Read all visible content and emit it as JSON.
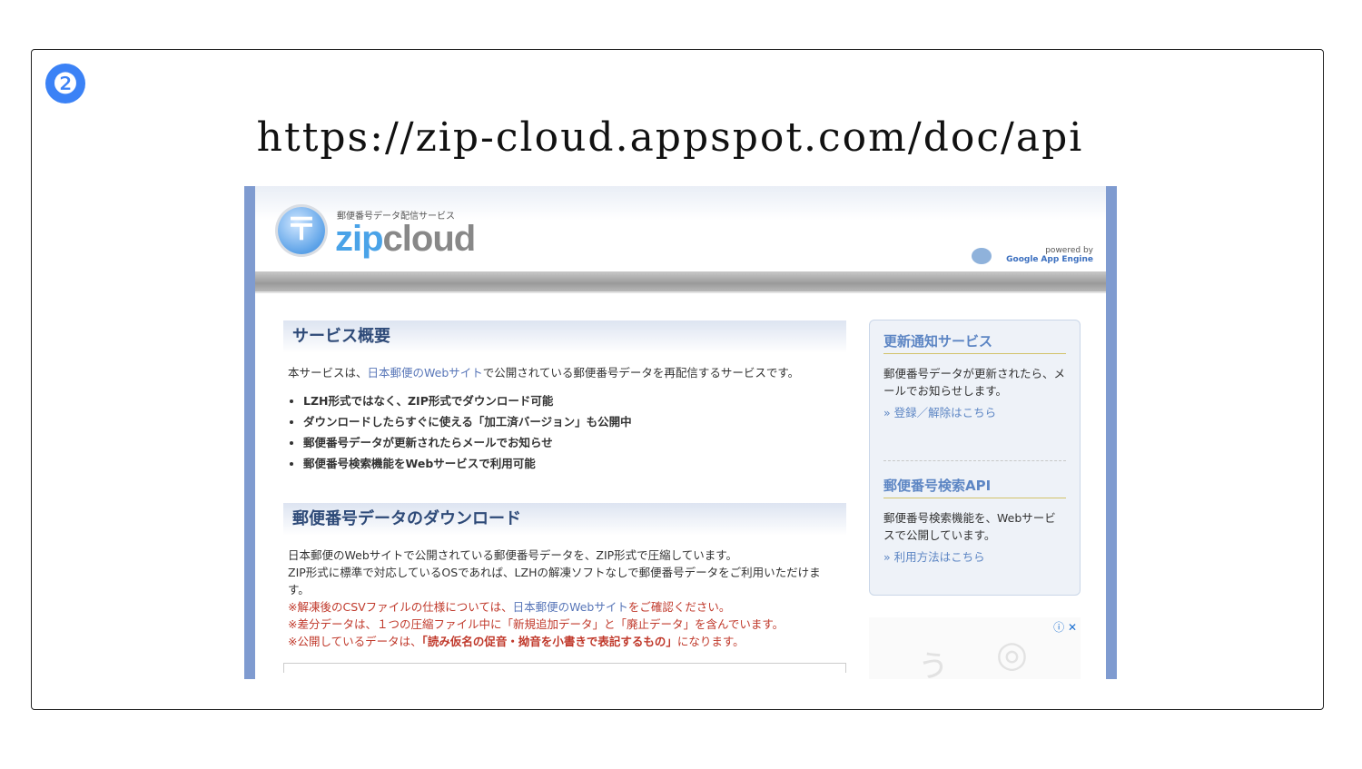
{
  "slide": {
    "badge": "❷",
    "url_title": "https://zip-cloud.appspot.com/doc/api"
  },
  "site": {
    "logo_symbol": "〒",
    "logo_tagline": "郵便番号データ配信サービス",
    "logo_zip": "zip",
    "logo_cloud": "cloud",
    "gae_powered": "powered by",
    "gae_google": "Google",
    "gae_engine": "App Engine"
  },
  "main": {
    "overview_heading": "サービス概要",
    "overview_intro_pre": "本サービスは、",
    "overview_intro_link": "日本郵便のWebサイト",
    "overview_intro_post": "で公開されている郵便番号データを再配信するサービスです。",
    "features": [
      "LZH形式ではなく、ZIP形式でダウンロード可能",
      "ダウンロードしたらすぐに使える「加工済バージョン」も公開中",
      "郵便番号データが更新されたらメールでお知らせ",
      "郵便番号検索機能をWebサービスで利用可能"
    ],
    "download_heading": "郵便番号データのダウンロード",
    "download_line1": "日本郵便のWebサイトで公開されている郵便番号データを、ZIP形式で圧縮しています。",
    "download_line2": "ZIP形式に標準で対応しているOSであれば、LZHの解凍ソフトなしで郵便番号データをご利用いただけます。",
    "note1_pre": "※解凍後のCSVファイルの仕様については、",
    "note1_link": "日本郵便のWebサイト",
    "note1_post": "をご確認ください。",
    "note2": "※差分データは、１つの圧縮ファイル中に「新規追加データ」と「廃止データ」を含んでいます。",
    "note3_pre": "※公開しているデータは、",
    "note3_bold": "「読み仮名の促音・拗音を小書きで表記するもの」",
    "note3_post": "になります。"
  },
  "sidebar": {
    "notify_heading": "更新通知サービス",
    "notify_text": "郵便番号データが更新されたら、メールでお知らせします。",
    "notify_link": "» 登録／解除はこちら",
    "api_heading": "郵便番号検索API",
    "api_text": "郵便番号検索機能を、Webサービスで公開しています。",
    "api_link": "» 利用方法はこちら"
  },
  "ad": {
    "info_icon": "ⓘ",
    "close_icon": "✕"
  }
}
